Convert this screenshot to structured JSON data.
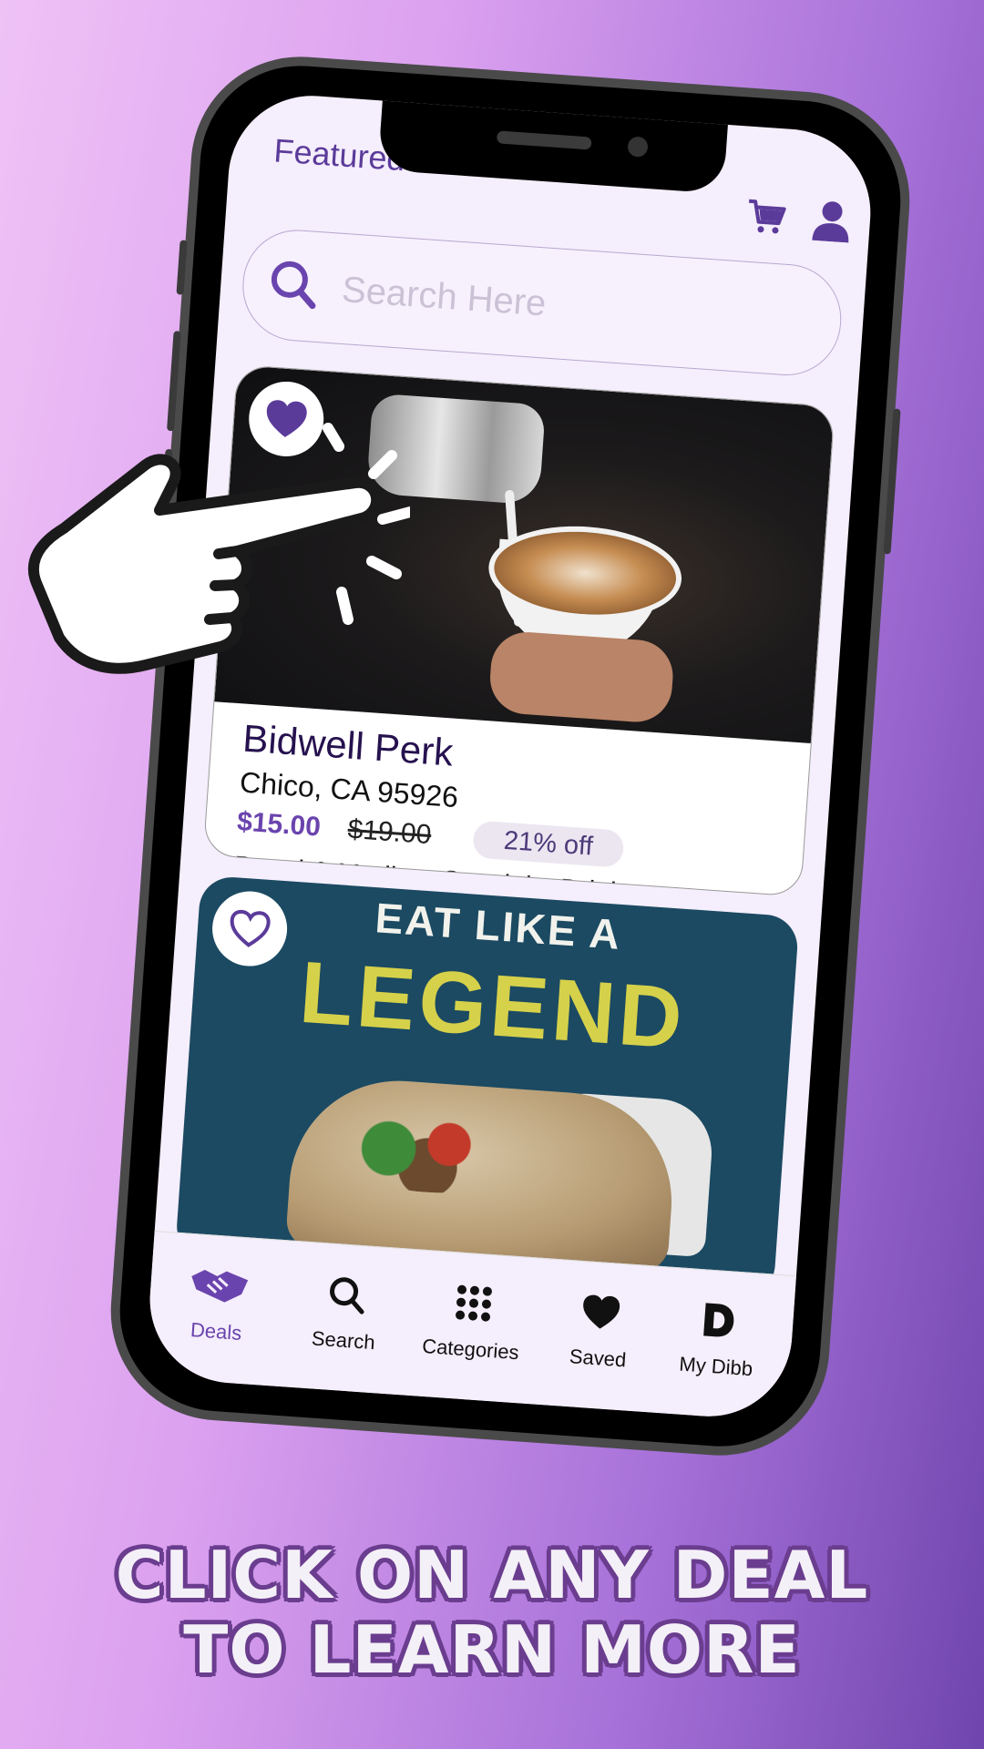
{
  "header": {
    "title": "Featured Deals"
  },
  "search": {
    "placeholder": "Search Here"
  },
  "deals": [
    {
      "name": "Bidwell Perk",
      "location": "Chico, CA 95926",
      "price": "$15.00",
      "original_price": "$19.00",
      "discount": "21% off",
      "description": "Bagel & Medium Specialty Drink",
      "saved": true
    },
    {
      "banner_line1": "EAT LIKE A",
      "banner_line2": "LEGEND",
      "saved": false
    }
  ],
  "tabs": [
    {
      "label": "Deals",
      "icon": "handshake-icon",
      "active": true
    },
    {
      "label": "Search",
      "icon": "search-icon"
    },
    {
      "label": "Categories",
      "icon": "grid-dots-icon"
    },
    {
      "label": "Saved",
      "icon": "heart-icon"
    },
    {
      "label": "My Dibb",
      "icon": "d-logo-icon"
    }
  ],
  "caption": {
    "line1": "CLICK ON ANY DEAL",
    "line2": "TO LEARN MORE"
  },
  "colors": {
    "brand": "#6a44ae",
    "title": "#5b3b9a"
  }
}
